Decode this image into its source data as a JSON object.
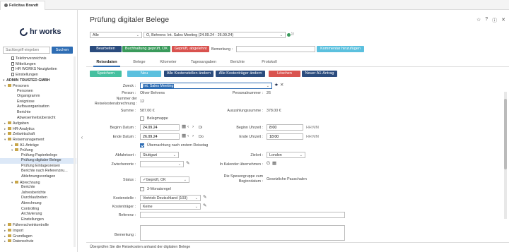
{
  "browser": {
    "tab_user": "Felicitas Brandt"
  },
  "sidebar": {
    "search_placeholder": "Suchbegriff eingeben",
    "search_button": "Suchen",
    "items": [
      {
        "label": "Telefonverzeichnis",
        "level": 2,
        "type": "doc"
      },
      {
        "label": "Mitteilungen",
        "level": 2,
        "type": "doc"
      },
      {
        "label": "HR WORKS Neuigkeiten",
        "level": 2,
        "type": "doc"
      },
      {
        "label": "Einstellungen",
        "level": 2,
        "type": "doc"
      },
      {
        "label": "ADMIN TRUSTED GMBH",
        "level": 0,
        "type": "group",
        "toggle": "▾"
      },
      {
        "label": "Personen",
        "level": 1,
        "type": "folder",
        "toggle": "▾"
      },
      {
        "label": "Personen",
        "level": 3,
        "type": "text"
      },
      {
        "label": "Organigramm",
        "level": 3,
        "type": "text"
      },
      {
        "label": "Ereignisse",
        "level": 3,
        "type": "text"
      },
      {
        "label": "Aufbauorganisation",
        "level": 3,
        "type": "text"
      },
      {
        "label": "Berichte",
        "level": 3,
        "type": "text"
      },
      {
        "label": "Abwesenheitsübersicht",
        "level": 3,
        "type": "text"
      },
      {
        "label": "Aufgaben",
        "level": 1,
        "type": "folder",
        "toggle": "▸"
      },
      {
        "label": "HR-Analytics",
        "level": 1,
        "type": "folder",
        "toggle": "▸"
      },
      {
        "label": "Zeitwirtschaft",
        "level": 1,
        "type": "folder",
        "toggle": "▸"
      },
      {
        "label": "Reisemanagement",
        "level": 1,
        "type": "folder",
        "toggle": "▾"
      },
      {
        "label": "A1-Anträge",
        "level": 2,
        "type": "folder",
        "toggle": "▸"
      },
      {
        "label": "Prüfung",
        "level": 2,
        "type": "folder",
        "toggle": "▾"
      },
      {
        "label": "Prüfung Papierbelege",
        "level": 4,
        "type": "text"
      },
      {
        "label": "Prüfung digitaler Belege",
        "level": 4,
        "type": "text",
        "selected": true
      },
      {
        "label": "Prüfung Eintagesreisen",
        "level": 4,
        "type": "text"
      },
      {
        "label": "Berichte nach Referenznu...",
        "level": 4,
        "type": "text"
      },
      {
        "label": "Ablehnungsvorlagen",
        "level": 4,
        "type": "text"
      },
      {
        "label": "Abrechnung",
        "level": 2,
        "type": "folder",
        "toggle": "▾"
      },
      {
        "label": "Berichte",
        "level": 4,
        "type": "text"
      },
      {
        "label": "Jahresberichte",
        "level": 4,
        "type": "text"
      },
      {
        "label": "Durchlaufzeiten",
        "level": 4,
        "type": "text"
      },
      {
        "label": "Abrechnung",
        "level": 4,
        "type": "text"
      },
      {
        "label": "Controlling",
        "level": 4,
        "type": "text"
      },
      {
        "label": "Archivierung",
        "level": 4,
        "type": "text"
      },
      {
        "label": "Einstellungen",
        "level": 4,
        "type": "text"
      },
      {
        "label": "Führerscheinkontrolle",
        "level": 1,
        "type": "folder",
        "toggle": "▸"
      },
      {
        "label": "Import",
        "level": 1,
        "type": "folder",
        "toggle": "▸"
      },
      {
        "label": "Grundlagen",
        "level": 1,
        "type": "folder",
        "toggle": "▸"
      },
      {
        "label": "Datenschutz",
        "level": 1,
        "type": "folder",
        "toggle": "▸"
      }
    ]
  },
  "main": {
    "title": "Prüfung digitaler Belege",
    "filter_all": "Alle",
    "filter_trip": "O, Behrens: Int. Sales Meeting (24.09.24 - 26.09.24)",
    "actions": {
      "edit": "Bearbeiten",
      "approve": "Buchhaltung geprüft, OK",
      "reject": "Geprüft, abgelehnt",
      "remark_label": "Bemerkung :",
      "add_comment": "Kommentar hinzufügen"
    },
    "tabs": [
      "Reisedaten",
      "Belege",
      "Kilometer",
      "Tagesangaben",
      "Berichte",
      "Protokoll"
    ],
    "form_actions": {
      "save": "Speichern",
      "new": "Neu",
      "change_all_cost_centers": "Alle Kostenstellen ändern",
      "change_all_cost_bearers": "Alle Kostenträger ändern",
      "delete": "Löschen",
      "new_a1": "Neuer A1-Antrag"
    },
    "form": {
      "zweck_label": "Zweck :",
      "zweck_value": "Int. Sales Meeting",
      "person_label": "Person :",
      "person_value": "Oliver Behrens",
      "personalnummer_label": "Personalnummer :",
      "personalnummer_value": "26",
      "nummer_label": "Nummer der Reisekostenabrechnung :",
      "nummer_value": "12",
      "summe_label": "Summe :",
      "summe_value": "587.00 €",
      "auszahlung_label": "Auszahlungssumme :",
      "auszahlung_value": "378.00 €",
      "belegmappe_label": "Belegmappe",
      "beginn_datum_label": "Beginn Datum :",
      "beginn_datum_value": "24.09.24",
      "beginn_weekday": "Di",
      "ende_datum_label": "Ende Datum :",
      "ende_datum_value": "26.09.24",
      "ende_weekday": "Do",
      "beginn_uhrzeit_label": "Beginn Uhrzeit :",
      "beginn_uhrzeit_value": "8:00",
      "ende_uhrzeit_label": "Ende Uhrzeit :",
      "ende_uhrzeit_value": "18:00",
      "time_format": "HH:MM",
      "uebernachtung_label": "Übernachtung nach erstem Reisetag",
      "abfahrtsort_label": "Abfahrtsort :",
      "abfahrtsort_value": "Stuttgart",
      "zielort_label": "Zielort :",
      "zielort_value": "London",
      "zwischenorte_label": "Zwischenorte :",
      "kalender_label": "In Kalender übernehmen :",
      "status_label": "Status :",
      "status_value": "✓Geprüft, OK",
      "spesen_label": "Die Spesengruppe zum Beginndatum :",
      "spesen_value": "Gesetzliche Pauschalen",
      "monatsregel_label": "3-Monatsregel",
      "kostenstelle_label": "Kostenstelle :",
      "kostenstelle_value": "Vertrieb Deutschland (103)",
      "kostentraeger_label": "Kostenträger :",
      "kostentraeger_value": "Keine",
      "referenz_label": "Referenz :",
      "bemerkung_label": "Bemerkung :"
    },
    "footer": "Überprüfen Sie die Reisekosten anhand der digitalen Belege"
  }
}
